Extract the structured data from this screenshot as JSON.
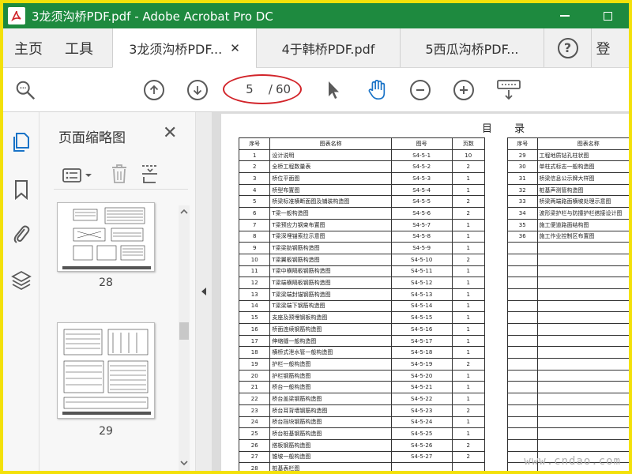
{
  "window": {
    "title": "3龙须沟桥PDF.pdf - Adobe Acrobat Pro DC",
    "app_icon": "acrobat-icon"
  },
  "menu": {
    "home": "主页",
    "tools": "工具"
  },
  "tabs": [
    {
      "label": "3龙须沟桥PDF...",
      "active": true
    },
    {
      "label": "4于韩桥PDF.pdf",
      "active": false
    },
    {
      "label": "5西瓜沟桥PDF...",
      "active": false
    }
  ],
  "tab_close": "✕",
  "help_label": "?",
  "signin_stub": "登",
  "toolbar": {
    "current_page": "5",
    "separator": "/",
    "total_pages": "60"
  },
  "sidebar": {
    "panel_title": "页面缩略图",
    "close_label": "✕",
    "thumbnails": [
      {
        "page_label": "28"
      },
      {
        "page_label": "29"
      }
    ]
  },
  "document": {
    "heading": "目 录",
    "columns": [
      "序号",
      "图表名称",
      "图号",
      "页数"
    ],
    "left_rows": [
      [
        "1",
        "设计说明",
        "S4-5-1",
        "10"
      ],
      [
        "2",
        "全桥工程数量表",
        "S4-5-2",
        "2"
      ],
      [
        "3",
        "桥位平面图",
        "S4-5-3",
        "1"
      ],
      [
        "4",
        "桥型布置图",
        "S4-5-4",
        "1"
      ],
      [
        "5",
        "桥梁标准横断面图及铺装构造图",
        "S4-5-5",
        "2"
      ],
      [
        "6",
        "T梁一般构造图",
        "S4-5-6",
        "2"
      ],
      [
        "7",
        "T梁预应力钢束布置图",
        "S4-5-7",
        "1"
      ],
      [
        "8",
        "T梁深埋锚索拉示意图",
        "S4-5-8",
        "1"
      ],
      [
        "9",
        "T梁梁肋钢筋构造图",
        "S4-5-9",
        "1"
      ],
      [
        "10",
        "T梁翼板钢筋构造图",
        "S4-5-10",
        "2"
      ],
      [
        "11",
        "T梁中横隔板钢筋构造图",
        "S4-5-11",
        "1"
      ],
      [
        "12",
        "T梁端横隔板钢筋构造图",
        "S4-5-12",
        "1"
      ],
      [
        "13",
        "T梁梁端封锚钢筋构造图",
        "S4-5-13",
        "1"
      ],
      [
        "14",
        "T梁梁端下钢筋构造图",
        "S4-5-14",
        "1"
      ],
      [
        "15",
        "支座及预埋钢板构造图",
        "S4-5-15",
        "1"
      ],
      [
        "16",
        "桥面连续钢筋构造图",
        "S4-5-16",
        "1"
      ],
      [
        "17",
        "伸缩缝一般构造图",
        "S4-5-17",
        "1"
      ],
      [
        "18",
        "横桥式泄水管一般构造图",
        "S4-5-18",
        "1"
      ],
      [
        "19",
        "护栏一般构造图",
        "S4-5-19",
        "2"
      ],
      [
        "20",
        "护栏钢筋构造图",
        "S4-5-20",
        "1"
      ],
      [
        "21",
        "桥台一般构造图",
        "S4-5-21",
        "1"
      ],
      [
        "22",
        "桥台盖梁钢筋构造图",
        "S4-5-22",
        "1"
      ],
      [
        "23",
        "桥台耳背墙钢筋构造图",
        "S4-5-23",
        "2"
      ],
      [
        "24",
        "桥台挡块钢筋构造图",
        "S4-5-24",
        "1"
      ],
      [
        "25",
        "桥台桩基钢筋构造图",
        "S4-5-25",
        "1"
      ],
      [
        "26",
        "搭板钢筋构造图",
        "S4-5-26",
        "2"
      ],
      [
        "27",
        "锥坡一般构造图",
        "S4-5-27",
        "2"
      ],
      [
        "28",
        "桩基表栏图",
        "",
        ""
      ]
    ],
    "right_rows": [
      [
        "29",
        "工程地质钻孔柱状图"
      ],
      [
        "30",
        "单柱式标志一般构造图"
      ],
      [
        "31",
        "桥梁信息公示牌大样图"
      ],
      [
        "32",
        "桩基声测管构造图"
      ],
      [
        "33",
        "桥梁两端路面横坡处理示意图"
      ],
      [
        "34",
        "波形梁护栏与防撞护栏搭接设计图"
      ],
      [
        "35",
        "施工便道路面结构图"
      ],
      [
        "36",
        "施工作业控制区布置图"
      ]
    ],
    "watermark": "www.cndao.com"
  }
}
